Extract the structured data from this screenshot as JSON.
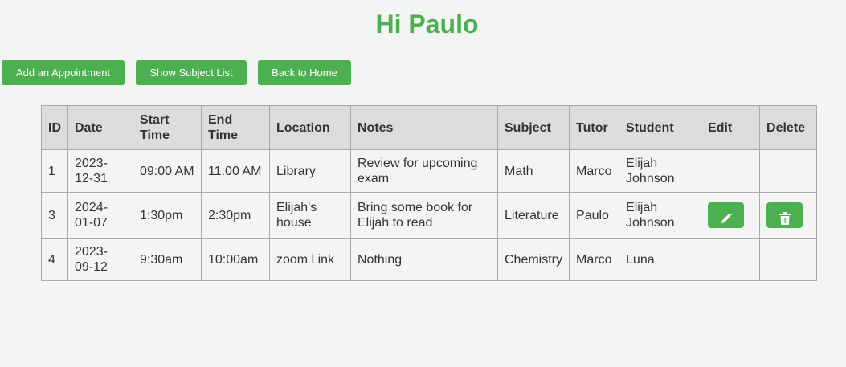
{
  "header": {
    "title": "Hi Paulo"
  },
  "toolbar": {
    "add_label": "Add an Appointment",
    "subjects_label": "Show Subject List",
    "home_label": "Back to Home"
  },
  "table": {
    "headers": {
      "id": "ID",
      "date": "Date",
      "start": "Start Time",
      "end": "End Time",
      "location": "Location",
      "notes": "Notes",
      "subject": "Subject",
      "tutor": "Tutor",
      "student": "Student",
      "edit": "Edit",
      "delete": "Delete"
    },
    "rows": [
      {
        "id": "1",
        "date": "2023-12-31",
        "start": "09:00 AM",
        "end": "11:00 AM",
        "location": "Library",
        "notes": "Review for upcoming exam",
        "subject": "Math",
        "tutor": "Marco",
        "student": "Elijah Johnson",
        "editable": false
      },
      {
        "id": "3",
        "date": "2024-01-07",
        "start": "1:30pm",
        "end": "2:30pm",
        "location": "Elijah's house",
        "notes": "Bring some book for Elijah to read",
        "subject": "Literature",
        "tutor": "Paulo",
        "student": "Elijah Johnson",
        "editable": true
      },
      {
        "id": "4",
        "date": "2023-09-12",
        "start": "9:30am",
        "end": "10:00am",
        "location": "zoom l ink",
        "notes": "Nothing",
        "subject": "Chemistry",
        "tutor": "Marco",
        "student": "Luna",
        "editable": false
      }
    ]
  },
  "icons": {
    "edit": "pencil-icon",
    "delete": "trash-icon"
  },
  "colors": {
    "accent": "#4caf50",
    "header_bg": "#dcdcdc",
    "page_bg": "#f4f4f4"
  }
}
